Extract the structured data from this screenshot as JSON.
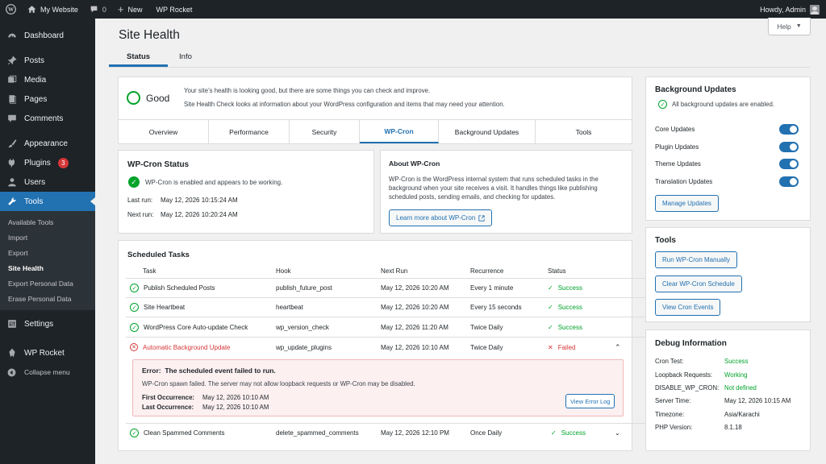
{
  "adminbar": {
    "site_name": "My Website",
    "comments_count": "0",
    "new_label": "New",
    "plugin_label": "WP Rocket",
    "greeting": "Howdy, Admin"
  },
  "sidebar": {
    "items": [
      {
        "label": "Dashboard",
        "icon": "dashboard-icon"
      },
      {
        "label": "Posts",
        "icon": "pin-icon"
      },
      {
        "label": "Media",
        "icon": "media-icon"
      },
      {
        "label": "Pages",
        "icon": "pages-icon"
      },
      {
        "label": "Comments",
        "icon": "comment-icon"
      },
      {
        "label": "Appearance",
        "icon": "brush-icon"
      },
      {
        "label": "Plugins",
        "icon": "plug-icon",
        "badge": "3"
      },
      {
        "label": "Users",
        "icon": "users-icon"
      },
      {
        "label": "Tools",
        "icon": "wrench-icon"
      }
    ],
    "tools_submenu": [
      "Available Tools",
      "Import",
      "Export",
      "Site Health",
      "Export Personal Data",
      "Erase Personal Data"
    ],
    "settings": "Settings",
    "wp_rocket": "WP Rocket",
    "collapse": "Collapse menu"
  },
  "header": {
    "title": "Site Health",
    "help": "Help",
    "tabs": [
      "Status",
      "Info"
    ]
  },
  "status": {
    "rating": "Good",
    "line1": "Your site’s health is looking good, but there are some things you can check and improve.",
    "line2": "Site Health Check looks at information about your WordPress configuration and items that may need your attention.",
    "subtabs": [
      "Overview",
      "Performance",
      "Security",
      "WP-Cron",
      "Background Updates",
      "Tools"
    ]
  },
  "cron_status": {
    "title": "WP-Cron Status",
    "message": "WP-Cron is enabled and appears to be working.",
    "last_run_label": "Last run:",
    "last_run": "May 12, 2026 10:15:24 AM",
    "next_run_label": "Next run:",
    "next_run": "May 12, 2026 10:20:24 AM"
  },
  "about_cron": {
    "title": "About WP-Cron",
    "text": "WP-Cron is the WordPress internal system that runs scheduled tasks in the background when your site receives a visit. It handles things like publishing scheduled posts, sending emails, and checking for updates.",
    "link": "Learn more about WP-Cron"
  },
  "scheduled": {
    "title": "Scheduled Tasks",
    "columns": [
      "Task",
      "Hook",
      "Next Run",
      "Recurrence",
      "Status"
    ],
    "rows": [
      {
        "task": "Publish Scheduled Posts",
        "hook": "publish_future_post",
        "next": "May 12, 2026 10:20 AM",
        "recurrence": "Every 1 minute",
        "status": "Success"
      },
      {
        "task": "Site Heartbeat",
        "hook": "heartbeat",
        "next": "May 12, 2026 10:20 AM",
        "recurrence": "Every 15 seconds",
        "status": "Success"
      },
      {
        "task": "WordPress Core Auto-update Check",
        "hook": "wp_version_check",
        "next": "May 12, 2026 11:20 AM",
        "recurrence": "Twice Daily",
        "status": "Success"
      },
      {
        "task": "Automatic Background Update",
        "hook": "wp_update_plugins",
        "next": "May 12, 2026 10:10 AM",
        "recurrence": "Twice Daily",
        "status": "Failed"
      },
      {
        "task": "Clean Spammed Comments",
        "hook": "delete_spammed_comments",
        "next": "May 12, 2026 12:10 PM",
        "recurrence": "Once Daily",
        "status": "Success"
      }
    ],
    "error": {
      "title": "Error:  The scheduled event failed to run.",
      "detail": "WP-Cron spawn failed. The server may not allow loopback requests or WP-Cron may be disabled.",
      "first_label": "First Occurrence:",
      "first": "May 12, 2026 10:10 AM",
      "last_label": "Last Occurrence:",
      "last": "May 12, 2026 10:10 AM",
      "button": "View Error Log"
    }
  },
  "bg_updates": {
    "title": "Background Updates",
    "message": "All background updates are enabled.",
    "toggles": [
      "Core Updates",
      "Plugin Updates",
      "Theme Updates",
      "Translation Updates"
    ],
    "button": "Manage Updates"
  },
  "tools": {
    "title": "Tools",
    "buttons": [
      "Run WP-Cron Manually",
      "Clear WP-Cron Schedule",
      "View Cron Events"
    ]
  },
  "debug": {
    "title": "Debug Information",
    "rows": [
      {
        "k": "Cron Test:",
        "v": "Success",
        "color": "#00a32a"
      },
      {
        "k": "Loopback Requests:",
        "v": "Working",
        "color": "#00a32a"
      },
      {
        "k": "DISABLE_WP_CRON:",
        "v": "Not defined",
        "color": "#00a32a"
      },
      {
        "k": "Server Time:",
        "v": "May 12, 2026 10:15 AM",
        "color": "#1d2327"
      },
      {
        "k": "Timezone:",
        "v": "Asia/Karachi",
        "color": "#1d2327"
      },
      {
        "k": "PHP Version:",
        "v": "8.1.18",
        "color": "#1d2327"
      }
    ]
  }
}
